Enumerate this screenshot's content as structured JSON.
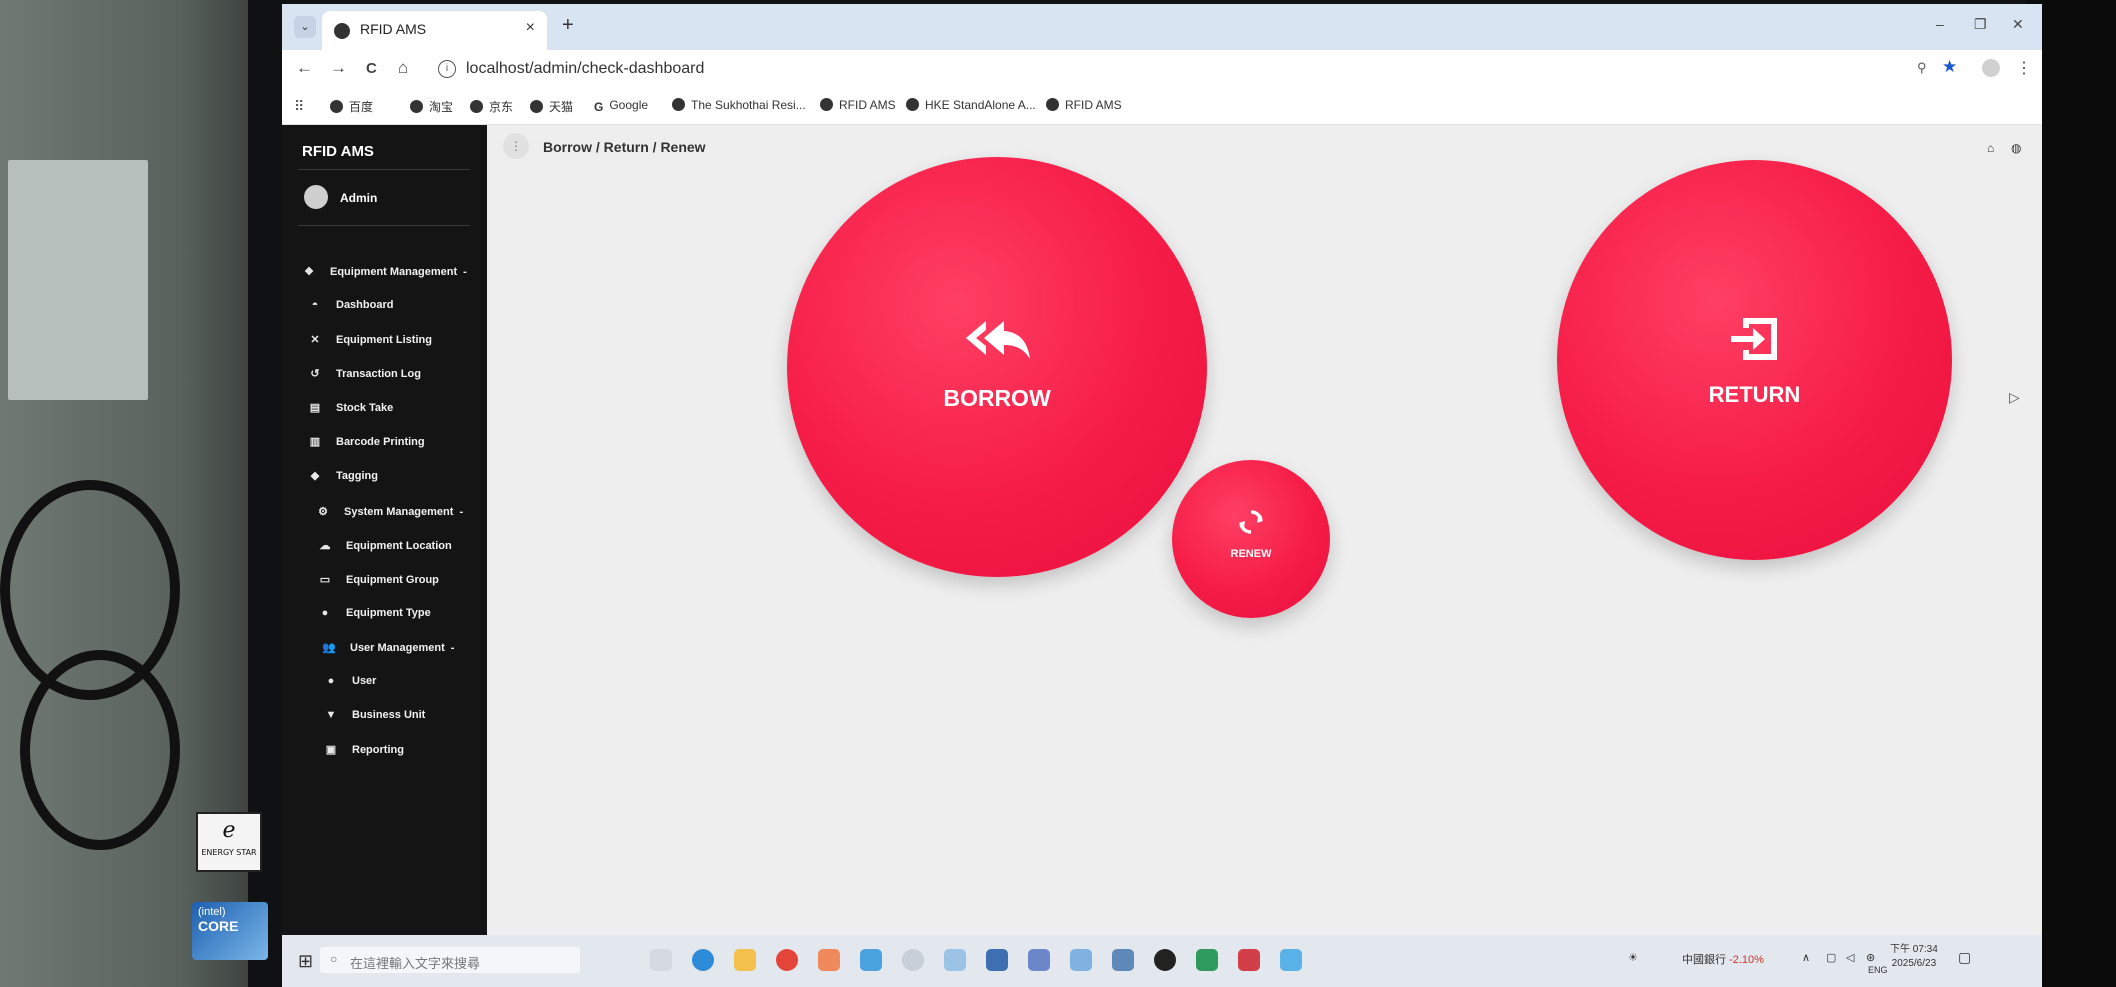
{
  "browser": {
    "tab_title": "RFID AMS",
    "tab_close": "×",
    "new_tab": "+",
    "tab_search": "⌄",
    "url": "localhost/admin/check-dashboard",
    "nav": {
      "back": "←",
      "forward": "→",
      "reload": "C",
      "home": "⌂"
    },
    "window_controls": {
      "minimize": "–",
      "restore": "❐",
      "close": "✕"
    },
    "bookmarks": [
      {
        "label": "百度",
        "icon": "globe-icon"
      },
      {
        "label": "淘宝",
        "icon": "globe-icon"
      },
      {
        "label": "京东",
        "icon": "globe-icon"
      },
      {
        "label": "天猫",
        "icon": "globe-icon"
      },
      {
        "label": "Google",
        "icon": "google-icon"
      },
      {
        "label": "The Sukhothai Resi...",
        "icon": "globe-icon"
      },
      {
        "label": "RFID AMS",
        "icon": "globe-icon"
      },
      {
        "label": "HKE StandAlone A...",
        "icon": "globe-icon"
      },
      {
        "label": "RFID AMS",
        "icon": "globe-icon"
      }
    ]
  },
  "sidebar": {
    "brand": "RFID AMS",
    "user": "Admin",
    "items": [
      {
        "label": "Equipment Management",
        "icon": "layers-icon",
        "caret": "-",
        "level": 0
      },
      {
        "label": "Dashboard",
        "icon": "dashboard-icon",
        "caret": "",
        "level": 1
      },
      {
        "label": "Equipment Listing",
        "icon": "list-icon",
        "caret": "",
        "level": 1
      },
      {
        "label": "Transaction Log",
        "icon": "history-icon",
        "caret": "",
        "level": 1
      },
      {
        "label": "Stock Take",
        "icon": "box-icon",
        "caret": "",
        "level": 1
      },
      {
        "label": "Barcode Printing",
        "icon": "barcode-icon",
        "caret": "",
        "level": 1
      },
      {
        "label": "Tagging",
        "icon": "tag-icon",
        "caret": "",
        "level": 1
      },
      {
        "label": "System Management",
        "icon": "gear-icon",
        "caret": "-",
        "level": 0
      },
      {
        "label": "Equipment Location",
        "icon": "location-icon",
        "caret": "",
        "level": 1
      },
      {
        "label": "Equipment Group",
        "icon": "group-icon",
        "caret": "",
        "level": 1
      },
      {
        "label": "Equipment Type",
        "icon": "type-icon",
        "caret": "",
        "level": 1
      },
      {
        "label": "User Management",
        "icon": "users-icon",
        "caret": "-",
        "level": 0
      },
      {
        "label": "User",
        "icon": "user-icon",
        "caret": "",
        "level": 1
      },
      {
        "label": "Business Unit",
        "icon": "filter-icon",
        "caret": "",
        "level": 1
      },
      {
        "label": "Reporting",
        "icon": "report-icon",
        "caret": "",
        "level": 0
      }
    ]
  },
  "header": {
    "breadcrumb": "Borrow / Return / Renew",
    "menu_toggle": "⋮"
  },
  "actions": {
    "borrow": {
      "label": "BORROW",
      "icon": "reply-all-icon"
    },
    "return": {
      "label": "RETURN",
      "icon": "sign-in-icon"
    },
    "renew": {
      "label": "RENEW",
      "icon": "refresh-icon"
    }
  },
  "colors": {
    "accent": "#f51c47",
    "sidebar_bg": "#141414"
  },
  "taskbar": {
    "search_placeholder": "在這裡輸入文字來搜尋",
    "stock_name": "中國銀行",
    "stock_change": "-2.10%",
    "language": "ENG",
    "time": "下午 07:34",
    "date": "2025/6/23"
  }
}
